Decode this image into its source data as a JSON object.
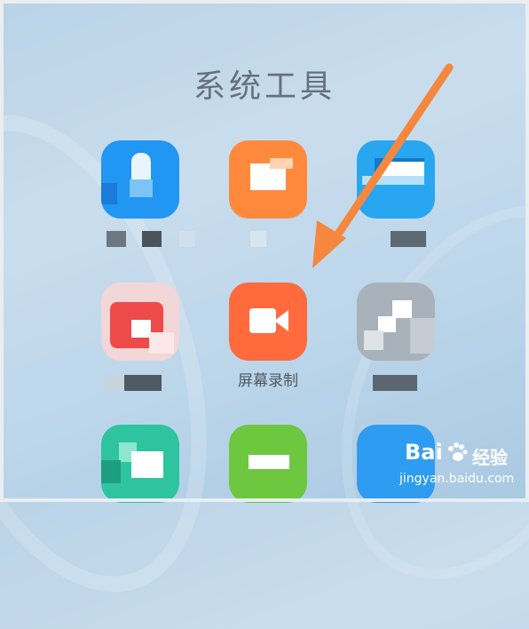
{
  "folder": {
    "title": "系统工具"
  },
  "apps": [
    {
      "id": "app-1",
      "label": "",
      "color": "#2196f3"
    },
    {
      "id": "app-2",
      "label": "",
      "color": "#ff8a3d"
    },
    {
      "id": "app-3",
      "label": "",
      "color": "#29a6f0"
    },
    {
      "id": "app-4",
      "label": "",
      "color": "#ef4a4a"
    },
    {
      "id": "screen-recorder",
      "label": "屏幕录制",
      "color": "#ff6b3d"
    },
    {
      "id": "app-6",
      "label": "",
      "color": "#a9b1ba"
    },
    {
      "id": "app-7",
      "label": "",
      "color": "#2ec4a0"
    },
    {
      "id": "app-8",
      "label": "",
      "color": "#6dc83f"
    },
    {
      "id": "app-9",
      "label": "",
      "color": "#2e9cf0"
    }
  ],
  "annotation": {
    "arrow_color": "#f5883e"
  },
  "watermark": {
    "brand": "Bai",
    "brand_suffix": "经验",
    "url": "jingyan.baidu.com"
  }
}
